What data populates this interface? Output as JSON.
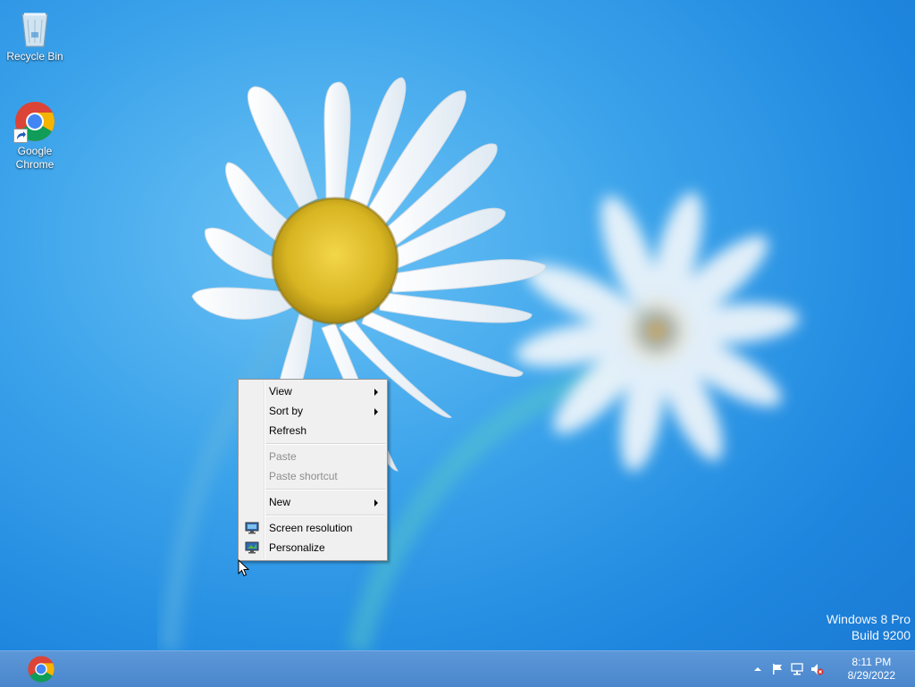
{
  "desktop": {
    "icons": [
      {
        "label": "Recycle Bin",
        "icon": "recycle-bin-icon"
      },
      {
        "label": "Google\nChrome",
        "line1": "Google",
        "line2": "Chrome",
        "icon": "chrome-icon"
      }
    ]
  },
  "context_menu": {
    "items": [
      {
        "label": "View",
        "submenu": true,
        "enabled": true
      },
      {
        "label": "Sort by",
        "submenu": true,
        "enabled": true
      },
      {
        "label": "Refresh",
        "submenu": false,
        "enabled": true
      },
      {
        "label": "Paste",
        "submenu": false,
        "enabled": false
      },
      {
        "label": "Paste shortcut",
        "submenu": false,
        "enabled": false
      },
      {
        "label": "New",
        "submenu": true,
        "enabled": true
      },
      {
        "label": "Screen resolution",
        "submenu": false,
        "enabled": true,
        "icon": "screen-resolution-icon"
      },
      {
        "label": "Personalize",
        "submenu": false,
        "enabled": true,
        "icon": "personalize-icon"
      }
    ]
  },
  "watermark": {
    "line1": "Windows 8 Pro",
    "line2": "Build 9200"
  },
  "taskbar": {
    "pinned": [
      {
        "icon": "chrome-icon"
      }
    ],
    "tray_icons": [
      "show-hidden-icons-arrow",
      "action-center-flag-icon",
      "network-icon",
      "volume-muted-icon"
    ],
    "clock": {
      "time": "8:11 PM",
      "date": "8/29/2022"
    }
  },
  "colors": {
    "desktop_bg": "#2a90e0",
    "taskbar": "#5088cf",
    "menu_bg": "#f0f0f0",
    "disabled_text": "#8d8d8d"
  }
}
